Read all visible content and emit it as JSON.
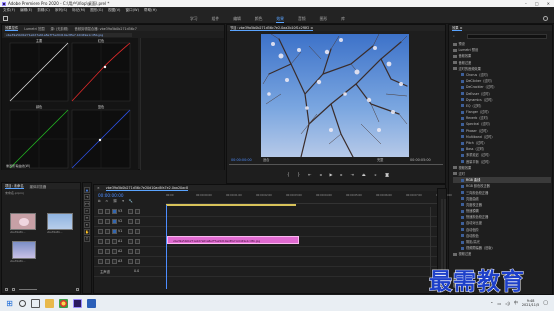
{
  "window": {
    "title": "Adobe Premiere Pro 2020 - C:\\用户\\Vlop\\桌面\\.prel *"
  },
  "menu": [
    "文件(F)",
    "编辑(E)",
    "剪辑(C)",
    "序列(S)",
    "标记(M)",
    "图形(G)",
    "视图(V)",
    "窗口(W)",
    "帮助(H)"
  ],
  "workspaces": {
    "tabs": [
      "学习",
      "组件",
      "编辑",
      "颜色",
      "效果",
      "音频",
      "图形",
      "库"
    ],
    "active": "效果"
  },
  "effect_controls": {
    "tabs": [
      "效果控件",
      "Lumetri 范围",
      "源: (无剪辑)",
      "音频剪辑混合器: vbe39a5b0b271d56c7"
    ],
    "clip": "vbe39a5b0b271e0d7a61a8e7f7e20d10ac8fa7-b0d49e1cd5b.jpg",
    "curve_labels": [
      "主要",
      "红色",
      "绿色",
      "蓝色"
    ],
    "reset": "重置所有曲线(W)"
  },
  "program": {
    "tab": "节目: vbe39a5b0b271d56c7e2.0aa2b10f1c2f8f2 ≡",
    "timecode_left": "00:00:00:00",
    "fit": "适合",
    "quality": "完整",
    "timecode_right": "00:00:05:00"
  },
  "project": {
    "tabs": [
      "项目: 未命名",
      "媒体浏览器"
    ],
    "file": "未命名.prproj",
    "items": [
      {
        "name": "vbe39a5b...",
        "dur": "5:00"
      },
      {
        "name": "vbe39a5b...",
        "dur": "5:00"
      },
      {
        "name": "vbe39a5b...",
        "dur": "5:00"
      }
    ]
  },
  "timeline": {
    "tab": "vbe39a5b0b271d56c7e20d10ac8fa7e2.0aa20ac8",
    "timecode": "00:00:00:00",
    "ruler": [
      "00:00",
      "00:00:00:00",
      "00:00:01:00",
      "00:00:02:00",
      "00:00:03:00",
      "00:00:04:00",
      "00:00:05:00",
      "00:00:06:00",
      "00:00:07:00",
      "00:00:08:00"
    ],
    "tracks": [
      "V3",
      "V2",
      "V1",
      "A1",
      "A2",
      "A3"
    ],
    "master": "主声道",
    "master_val": "0.0",
    "clip": "vbe39a5b0b271e0d7a61a8e7f7e20d10ac8fa7-b0d49e1cd5b.jpg"
  },
  "effects": {
    "tab": "效果 ≡",
    "items": [
      {
        "t": "f",
        "n": "预设"
      },
      {
        "t": "f",
        "n": "Lumetri 预设"
      },
      {
        "t": "f",
        "n": "音频效果"
      },
      {
        "t": "f",
        "n": "音频过渡"
      },
      {
        "t": "f",
        "n": "过时的音频效果"
      },
      {
        "t": "e",
        "n": "Chorus（过时）"
      },
      {
        "t": "e",
        "n": "DeClicker（过时）"
      },
      {
        "t": "e",
        "n": "DeCrackler（过时）"
      },
      {
        "t": "e",
        "n": "DeEsser（过时）"
      },
      {
        "t": "e",
        "n": "Dynamics（过时）"
      },
      {
        "t": "e",
        "n": "EQ（过时）"
      },
      {
        "t": "e",
        "n": "Flanger（过时）"
      },
      {
        "t": "e",
        "n": "Reverb（过时）"
      },
      {
        "t": "e",
        "n": "Spectral（过时）"
      },
      {
        "t": "e",
        "n": "Phaser（过时）"
      },
      {
        "t": "e",
        "n": "Multiband（过时）"
      },
      {
        "t": "e",
        "n": "Pitch（过时）"
      },
      {
        "t": "e",
        "n": "Bass（过时）"
      },
      {
        "t": "e",
        "n": "多重延迟（过时）"
      },
      {
        "t": "e",
        "n": "音量平衡（过时）"
      },
      {
        "t": "f",
        "n": "视频效果"
      },
      {
        "t": "f",
        "n": "过时"
      },
      {
        "t": "s",
        "n": "RGB 曲线"
      },
      {
        "t": "e",
        "n": "RGB 颜色校正器"
      },
      {
        "t": "e",
        "n": "三向颜色校正器"
      },
      {
        "t": "e",
        "n": "亮度曲线"
      },
      {
        "t": "e",
        "n": "亮度校正器"
      },
      {
        "t": "e",
        "n": "快速模糊"
      },
      {
        "t": "e",
        "n": "快速颜色校正器"
      },
      {
        "t": "e",
        "n": "自动对比度"
      },
      {
        "t": "e",
        "n": "自动色阶"
      },
      {
        "t": "e",
        "n": "自动颜色"
      },
      {
        "t": "e",
        "n": "阴影/高光"
      },
      {
        "t": "e",
        "n": "视频限幅器（旧版）"
      },
      {
        "t": "f",
        "n": "视频过渡"
      }
    ],
    "essential_graphics": "基本图形",
    "essential_sound": "基本声音"
  },
  "watermark": "最需教育",
  "clock": {
    "time": "9:48",
    "date": "2021/11/5"
  }
}
